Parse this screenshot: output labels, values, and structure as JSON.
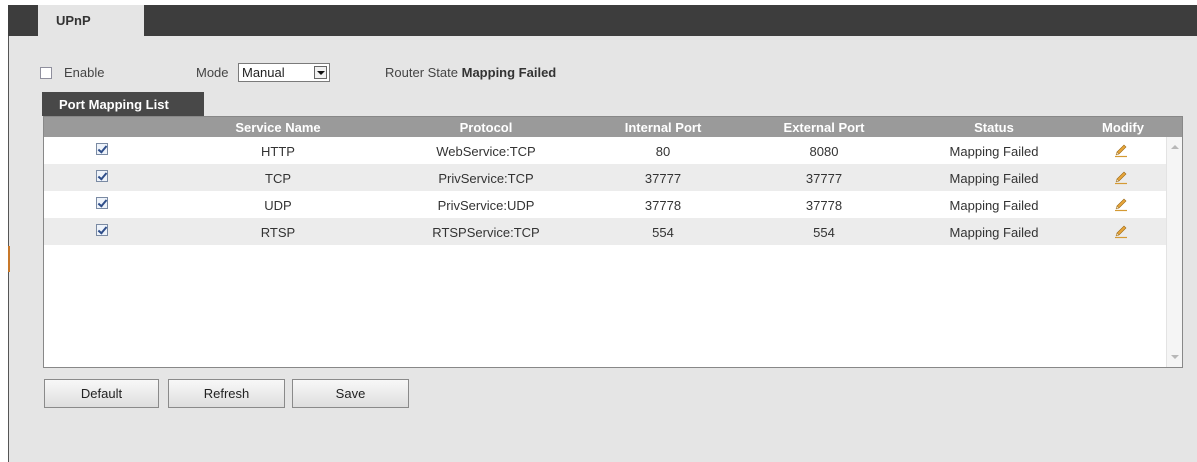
{
  "top_tab": {
    "label": "UPnP"
  },
  "settings": {
    "enable_label": "Enable",
    "enable_checked": false,
    "mode_label": "Mode",
    "mode_value": "Manual",
    "router_state_label": "Router State",
    "router_state_value": "Mapping Failed"
  },
  "list_tab": {
    "label": "Port Mapping List"
  },
  "table": {
    "headers": [
      "Service Name",
      "Protocol",
      "Internal Port",
      "External Port",
      "Status",
      "Modify"
    ],
    "rows": [
      {
        "checked": true,
        "service": "HTTP",
        "protocol": "WebService:TCP",
        "internal": "80",
        "external": "8080",
        "status": "Mapping Failed",
        "modify_icon": "pencil-icon"
      },
      {
        "checked": true,
        "service": "TCP",
        "protocol": "PrivService:TCP",
        "internal": "37777",
        "external": "37777",
        "status": "Mapping Failed",
        "modify_icon": "pencil-icon"
      },
      {
        "checked": true,
        "service": "UDP",
        "protocol": "PrivService:UDP",
        "internal": "37778",
        "external": "37778",
        "status": "Mapping Failed",
        "modify_icon": "pencil-icon"
      },
      {
        "checked": true,
        "service": "RTSP",
        "protocol": "RTSPService:TCP",
        "internal": "554",
        "external": "554",
        "status": "Mapping Failed",
        "modify_icon": "pencil-icon"
      }
    ]
  },
  "buttons": {
    "default": "Default",
    "refresh": "Refresh",
    "save": "Save"
  },
  "colors": {
    "topbar": "#3d3d3d",
    "panel": "#e5e5e5",
    "header": "#9a9a9a",
    "tab": "#484848"
  }
}
